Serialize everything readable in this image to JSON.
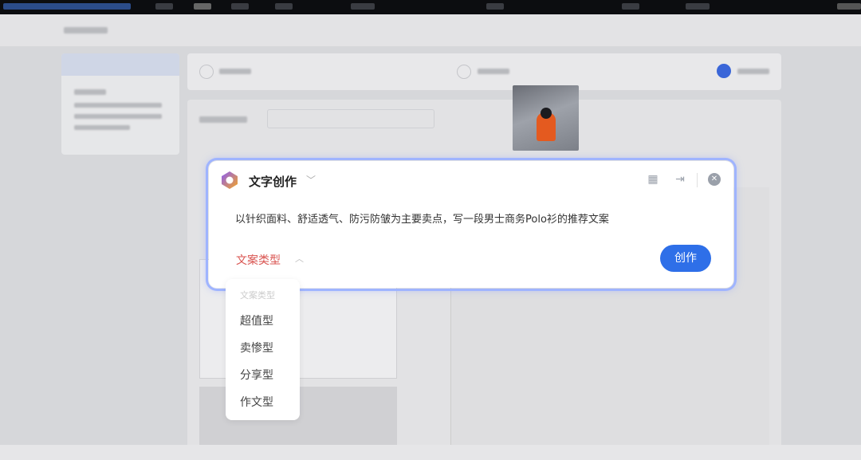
{
  "panel": {
    "title": "文字创作",
    "prompt": "以针织面料、舒适透气、防污防皱为主要卖点，写一段男士商务Polo衫的推荐文案",
    "type_label": "文案类型",
    "create_button": "创作",
    "icons": [
      "logo-icon",
      "chevron-down-icon",
      "grid-icon",
      "sidebar-toggle-icon",
      "close-icon",
      "chevron-up-icon"
    ]
  },
  "dropdown": {
    "header": "文案类型",
    "options": [
      "超值型",
      "卖惨型",
      "分享型",
      "作文型"
    ]
  },
  "colors": {
    "accent": "#2e6fe8",
    "type_label": "#d9534f"
  }
}
